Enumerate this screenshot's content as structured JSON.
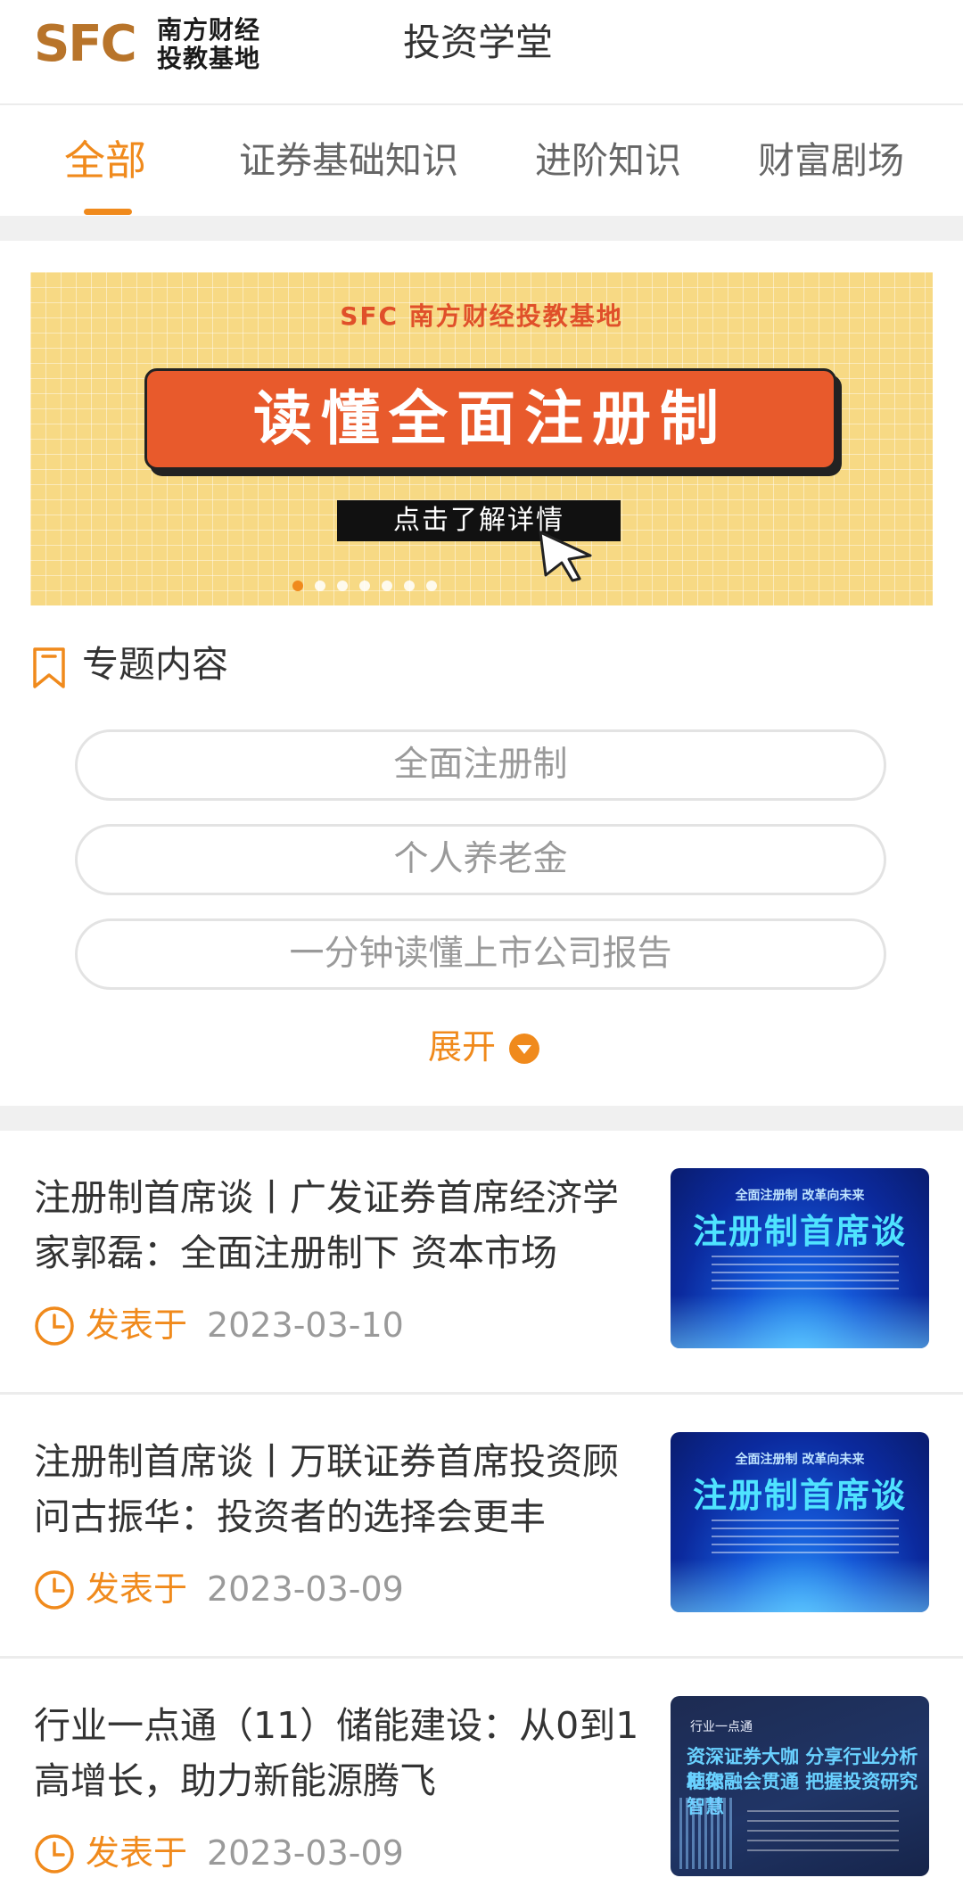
{
  "header": {
    "logo_mark": "SFC",
    "logo_text_line1": "南方财经",
    "logo_text_line2": "投教基地",
    "title": "投资学堂"
  },
  "tabs": [
    {
      "label": "全部",
      "active": true
    },
    {
      "label": "证券基础知识",
      "active": false
    },
    {
      "label": "进阶知识",
      "active": false
    },
    {
      "label": "财富剧场",
      "active": false
    }
  ],
  "banner": {
    "brand": "SFC 南方财经投教基地",
    "headline": "读懂全面注册制",
    "cta": "点击了解详情",
    "slide_count": 7,
    "active_index": 0,
    "bg_color": "#f7d984",
    "accent_color": "#e85a2c"
  },
  "topics_section": {
    "icon": "bookmark-icon",
    "title": "专题内容",
    "items": [
      "全面注册制",
      "个人养老金",
      "一分钟读懂上市公司报告"
    ],
    "expand_label": "展开",
    "expand_icon": "chevron-down-circle-icon"
  },
  "articles": [
    {
      "title": "注册制首席谈丨广发证券首席经济学家郭磊：全面注册制下 资本市场",
      "meta_label": "发表于",
      "date": "2023-03-10",
      "thumb_top": "全面注册制 改革向未来",
      "thumb_title": "注册制首席谈"
    },
    {
      "title": "注册制首席谈丨万联证券首席投资顾问古振华：投资者的选择会更丰",
      "meta_label": "发表于",
      "date": "2023-03-09",
      "thumb_top": "全面注册制 改革向未来",
      "thumb_title": "注册制首席谈"
    },
    {
      "title": "行业一点通（11）储能建设：从0到1高增长，助力新能源腾飞",
      "meta_label": "发表于",
      "date": "2023-03-09",
      "thumb_tag": "行业一点通",
      "thumb_line1": "资深证券大咖  分享行业分析框架",
      "thumb_line2": "助你融会贯通  把握投资研究智慧"
    }
  ],
  "colors": {
    "accent": "#f08a1c",
    "text": "#333333",
    "muted": "#9a9a9a",
    "divider": "#f0f0f0"
  }
}
